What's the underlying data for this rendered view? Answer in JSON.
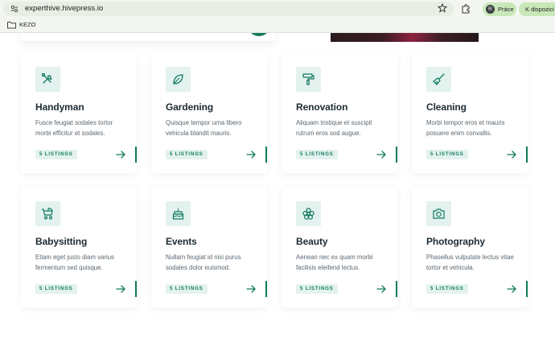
{
  "browser": {
    "url": "experthive.hivepress.io",
    "profile_initial": "R",
    "profile_label": "Práce",
    "notice_label": "K dispozici je",
    "bookmark_folder": "KEZO"
  },
  "categories": [
    {
      "title": "Handyman",
      "description": "Fusce feugiat sodales tortor morbi efficitur et sodales.",
      "listings": "5 LISTINGS",
      "icon": "tools-icon"
    },
    {
      "title": "Gardening",
      "description": "Quisque tempor urna libero vehicula blandit mauris.",
      "listings": "5 LISTINGS",
      "icon": "leaf-icon"
    },
    {
      "title": "Renovation",
      "description": "Aliquam tristique et suscipit rutrum eros sod augue.",
      "listings": "5 LISTINGS",
      "icon": "paint-roller-icon"
    },
    {
      "title": "Cleaning",
      "description": "Morbi tempor eros et mauris posuere enim convallis.",
      "listings": "5 LISTINGS",
      "icon": "broom-icon"
    },
    {
      "title": "Babysitting",
      "description": "Etiam eget justo diam varius fermentum sed quisque.",
      "listings": "5 LISTINGS",
      "icon": "stroller-icon"
    },
    {
      "title": "Events",
      "description": "Nullam feugiat id nisi purus sodales dolor euismod.",
      "listings": "5 LISTINGS",
      "icon": "cake-icon"
    },
    {
      "title": "Beauty",
      "description": "Aenean nec ex quam morbi facilisis eleifend lectus.",
      "listings": "5 LISTINGS",
      "icon": "flower-icon"
    },
    {
      "title": "Photography",
      "description": "Phasellus vulputate lectus vitae tortor et vehicula.",
      "listings": "5 LISTINGS",
      "icon": "camera-icon"
    }
  ],
  "colors": {
    "accent": "#0f7a5c",
    "icon_bg": "#e3f2ee"
  }
}
